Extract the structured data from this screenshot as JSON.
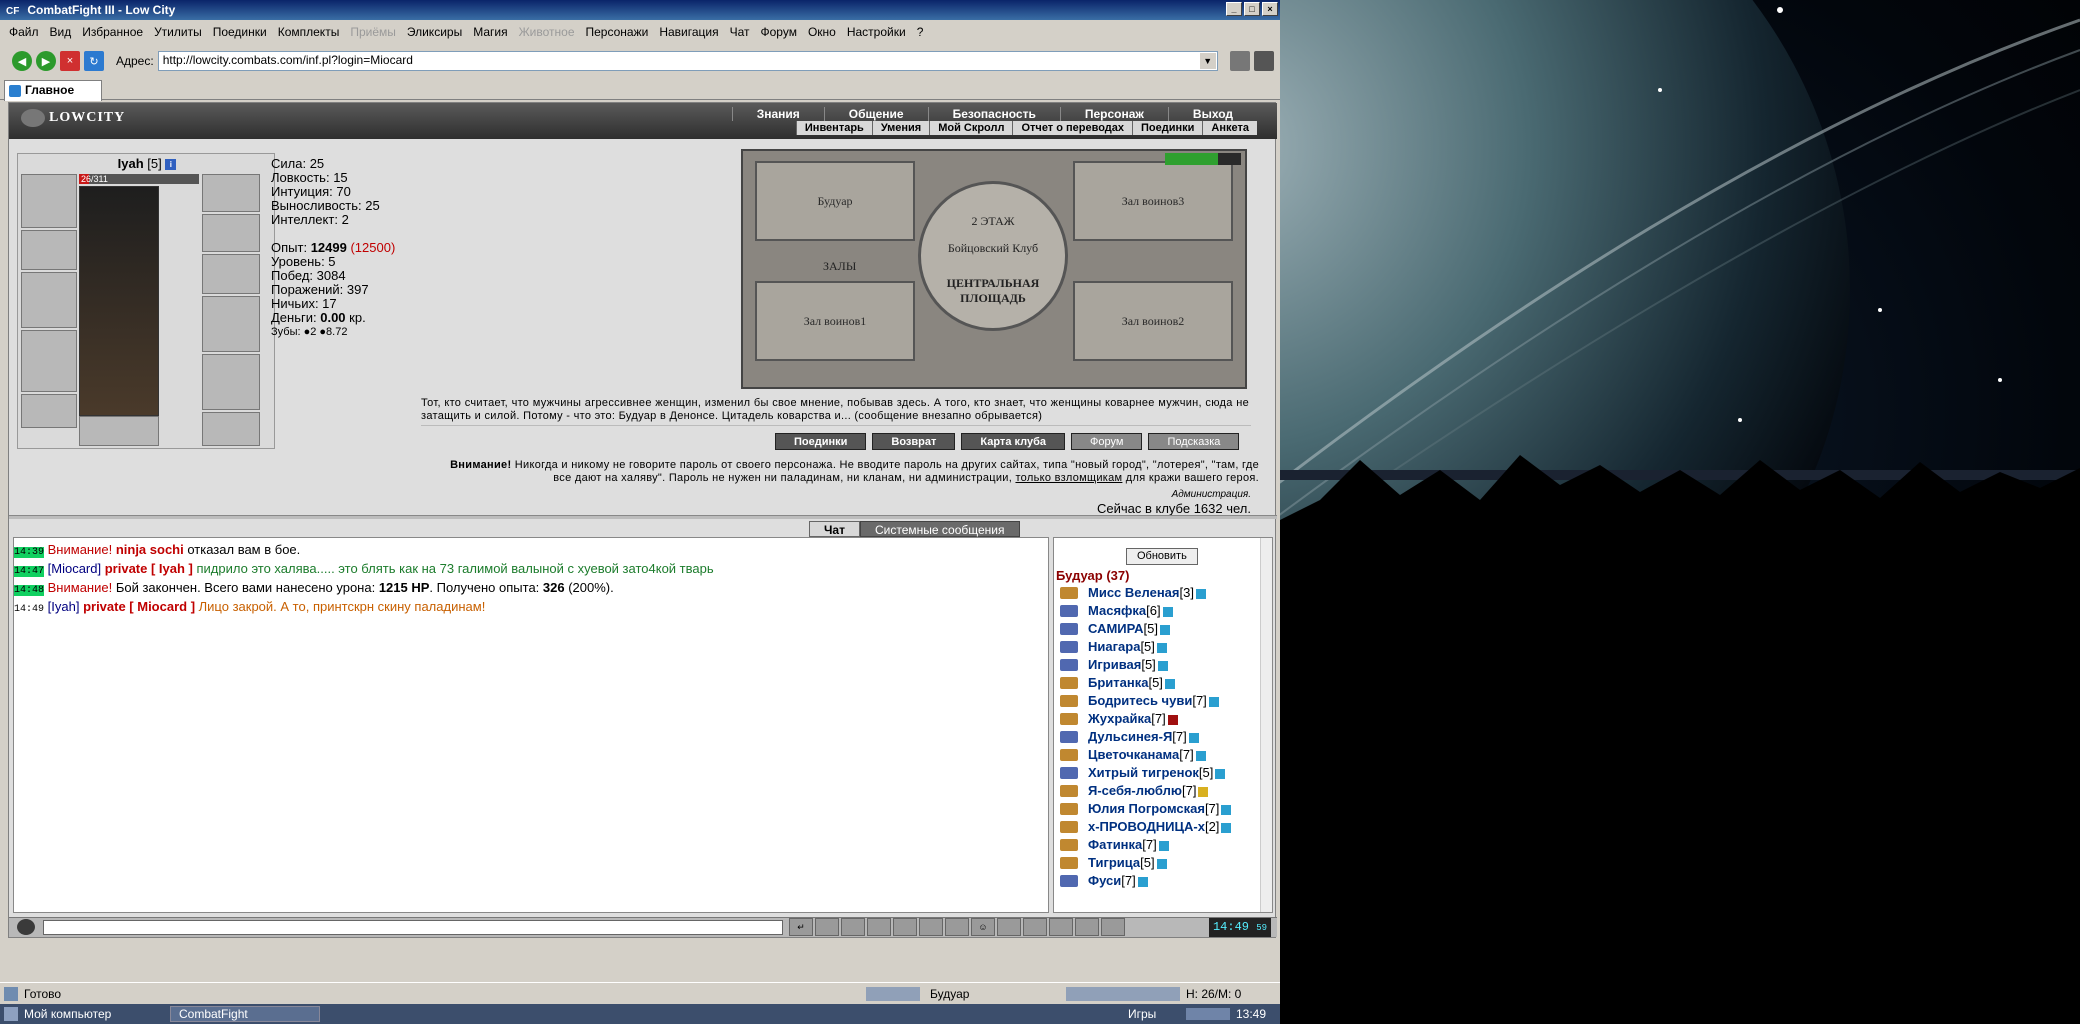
{
  "window": {
    "title": "CombatFight III - Low City",
    "icon": "CF"
  },
  "menu": [
    "Файл",
    "Вид",
    "Избранное",
    "Утилиты",
    "Поединки",
    "Комплекты",
    "Приёмы",
    "Эликсиры",
    "Магия",
    "Животное",
    "Персонажи",
    "Навигация",
    "Чат",
    "Форум",
    "Окно",
    "Настройки",
    "?"
  ],
  "menu_disabled": [
    "Приёмы",
    "Животное"
  ],
  "address": {
    "label": "Адрес:",
    "url": "http://lowcity.combats.com/inf.pl?login=Miocard"
  },
  "tab": {
    "label": "Главное"
  },
  "game": {
    "logo": "LOWCITY",
    "nav_top": [
      "Знания",
      "Общение",
      "Безопасность",
      "Персонаж",
      "Выход"
    ],
    "nav_sub": [
      "Инвентарь",
      "Умения",
      "Мой Скролл",
      "Отчет о переводах",
      "Поединки",
      "Анкета"
    ]
  },
  "character": {
    "name": "Iyah",
    "level": "[5]",
    "hp": "26/311",
    "hp_fraction": 0.084,
    "stats": [
      {
        "label": "Сила:",
        "value": "25"
      },
      {
        "label": "Ловкость:",
        "value": "15"
      },
      {
        "label": "Интуиция:",
        "value": "70"
      },
      {
        "label": "Выносливость:",
        "value": "25"
      },
      {
        "label": "Интеллект:",
        "value": "2"
      }
    ],
    "exp_label": "Опыт:",
    "exp_value": "12499",
    "exp_next": "(12500)",
    "level_label": "Уровень: 5",
    "wins": "Побед: 3084",
    "losses": "Поражений: 397",
    "draws": "Ничьих: 17",
    "money_label": "Деньги:",
    "money_value": "0.00",
    "money_unit": "кр.",
    "teeth": "Зубы: ●2 ●8.72"
  },
  "map": {
    "rooms": {
      "boudoir": "Будуар",
      "hall3": "Зал воинов3",
      "hall1": "Зал воинов1",
      "hall2": "Зал воинов2",
      "halls": "ЗАЛЫ"
    },
    "floor": "2 ЭТАЖ",
    "club": "Бойцовский Клуб",
    "square_line1": "ЦЕНТРАЛЬНАЯ",
    "square_line2": "ПЛОЩАДЬ"
  },
  "quote": "Тот, кто считает, что мужчины агрессивнее женщин, изменил бы свое мнение, побывав здесь. А того, кто знает, что женщины коварнее мужчин, сюда не затащить и силой. Потому - что это: Будуар в Денонсе. Цитадель коварства и... (сообщение внезапно обрывается)",
  "buttons": {
    "duels": "Поединки",
    "return": "Возврат",
    "club_map": "Карта клуба",
    "forum": "Форум",
    "hint": "Подсказка"
  },
  "warning": {
    "prefix": "Внимание!",
    "text": " Никогда и никому не говорите пароль от своего персонажа. Не вводите пароль на других сайтах, типа \"новый город\", \"лотерея\", \"там, где все дают на халяву\". Пароль не нужен ни паладинам, ни кланам, ни администрации, ",
    "link": "только взломщикам",
    "suffix": " для кражи вашего героя."
  },
  "admin": "Администрация.",
  "online": "Сейчас в клубе 1632 чел.",
  "chat_tabs": {
    "chat": "Чат",
    "system": "Системные сообщения"
  },
  "chat": {
    "l1": {
      "time": "14:39",
      "warn": "Внимание!",
      "nick": "ninja sochi",
      "text": " отказал вам в бое."
    },
    "l2": {
      "time": "14:47",
      "from": "[Miocard]",
      "priv": "private [ Iyah ]",
      "text": " пидрило это халява..... это блять как на 73 галимой валыной с хуевой зато4кой тварь"
    },
    "l3": {
      "time": "14:48",
      "warn": "Внимание!",
      "text1": " Бой закончен. Всего вами нанесено урона: ",
      "dmg": "1215 HP",
      "text2": ". Получено опыта: ",
      "exp": "326",
      "text3": " (200%)."
    },
    "l4": {
      "time": "14:49",
      "from": "[Iyah]",
      "priv": "private [ Miocard ]",
      "text": " Лицо закрой. А то, принтскрн скину паладинам!"
    }
  },
  "users": {
    "refresh": "Обновить",
    "room": "Будуар (37)",
    "list": [
      {
        "name": "Мисс Веленая",
        "level": "[3]"
      },
      {
        "name": "Масяфка",
        "level": "[6]"
      },
      {
        "name": "САМИРА",
        "level": "[5]"
      },
      {
        "name": "Ниагара",
        "level": "[5]"
      },
      {
        "name": "Игривая",
        "level": "[5]"
      },
      {
        "name": "Британка",
        "level": "[5]"
      },
      {
        "name": "Бодритесь чуви",
        "level": "[7]"
      },
      {
        "name": "Жухрайка",
        "level": "[7]"
      },
      {
        "name": "Дульсинея-Я",
        "level": "[7]"
      },
      {
        "name": "Цветочканама",
        "level": "[7]"
      },
      {
        "name": "Хитрый тигренок",
        "level": "[5]"
      },
      {
        "name": "Я-себя-люблю",
        "level": "[7]"
      },
      {
        "name": "Юлия Погромская",
        "level": "[7]"
      },
      {
        "name": "х-ПРОВОДНИЦА-х",
        "level": "[2]"
      },
      {
        "name": "Фатинка",
        "level": "[7]"
      },
      {
        "name": "Тигрица",
        "level": "[5]"
      },
      {
        "name": "Фуси",
        "level": "[7]"
      }
    ]
  },
  "clock": "14:49",
  "clock_sec": "59",
  "status": {
    "ready": "Готово",
    "room": "Будуар",
    "hp": "H: 26/M: 0"
  },
  "taskbar": {
    "start": "Мой компьютер",
    "task": "CombatFight",
    "games": "Игры",
    "time": "13:49"
  }
}
